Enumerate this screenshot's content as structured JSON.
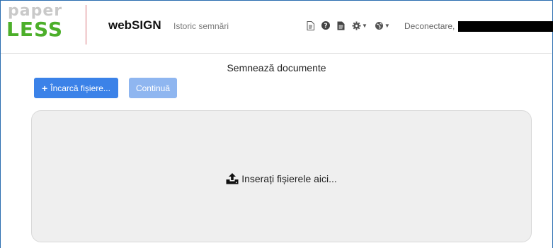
{
  "logo": {
    "top_text": "paper",
    "bottom_text": "LESS"
  },
  "header": {
    "brand": "webSIGN",
    "history_link": "Istoric semnări",
    "icons": [
      "document-icon",
      "help-icon",
      "file-icon",
      "gear-icon",
      "globe-icon"
    ],
    "logout_label": "Deconectare,"
  },
  "main": {
    "title": "Semnează documente",
    "upload_button": "Încarcă fișiere...",
    "continue_button": "Continuă",
    "dropzone_text": "Inserați fișierele aici..."
  },
  "colors": {
    "primary": "#3b82e8",
    "primary_disabled": "#8fb6f0",
    "logo_green": "#4caf2a",
    "logo_gray": "#c9c9c9"
  }
}
